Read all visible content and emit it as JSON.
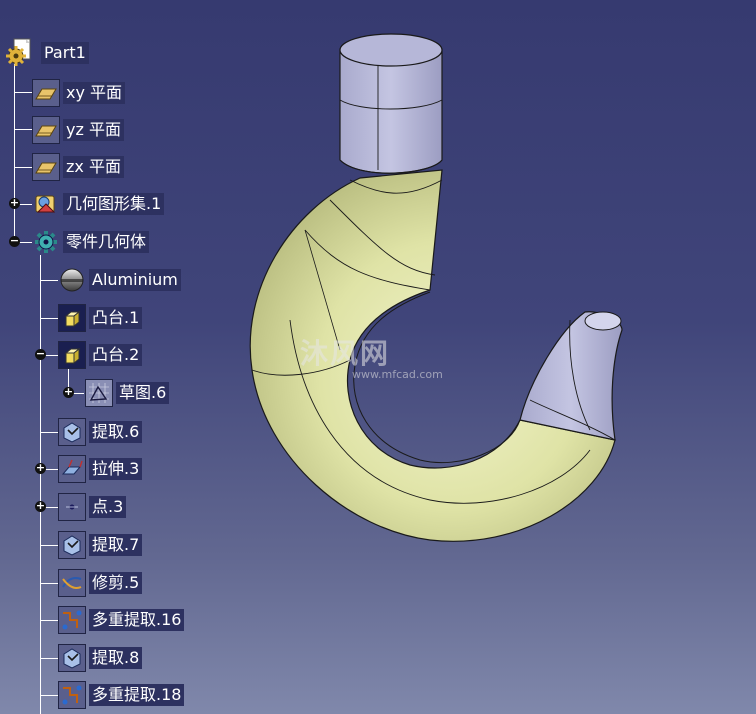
{
  "tree": {
    "root": "Part1",
    "items": [
      {
        "label": "xy 平面",
        "icon": "plane-icon"
      },
      {
        "label": "yz 平面",
        "icon": "plane-icon"
      },
      {
        "label": "zx 平面",
        "icon": "plane-icon"
      },
      {
        "label": "几何图形集.1",
        "icon": "geometric-set-icon"
      },
      {
        "label": "零件几何体",
        "icon": "part-body-icon"
      },
      {
        "label": "Aluminium",
        "icon": "material-icon"
      },
      {
        "label": "凸台.1",
        "icon": "pad-icon"
      },
      {
        "label": "凸台.2",
        "icon": "pad-icon"
      },
      {
        "label": "草图.6",
        "icon": "sketch-icon"
      },
      {
        "label": "提取.6",
        "icon": "extract-icon"
      },
      {
        "label": "拉伸.3",
        "icon": "extrude-icon"
      },
      {
        "label": "点.3",
        "icon": "point-icon"
      },
      {
        "label": "提取.7",
        "icon": "extract-icon"
      },
      {
        "label": "修剪.5",
        "icon": "trim-icon"
      },
      {
        "label": "多重提取.16",
        "icon": "multi-extract-icon"
      },
      {
        "label": "提取.8",
        "icon": "extract-icon"
      },
      {
        "label": "多重提取.18",
        "icon": "multi-extract-icon"
      }
    ]
  },
  "watermark": {
    "main": "沐风网",
    "sub": "www.mfcad.com"
  },
  "colors": {
    "background_top": "#363a70",
    "background_bottom": "#8088ab",
    "hook_body": "#dfe3a6",
    "hook_ends": "#b4b5d6"
  }
}
